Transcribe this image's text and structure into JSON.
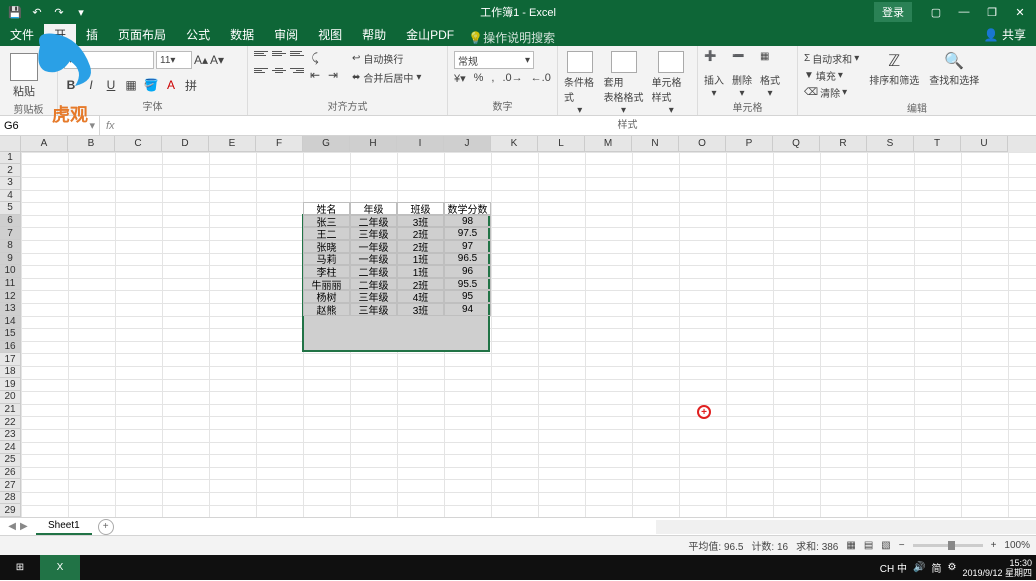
{
  "title_doc": "工作簿1 - Excel",
  "login_label": "登录",
  "tabs": [
    "文件",
    "开",
    "插",
    "页面布局",
    "公式",
    "数据",
    "审阅",
    "视图",
    "帮助",
    "金山PDF"
  ],
  "search_hint": "操作说明搜索",
  "share_label": "共享",
  "ribbon": {
    "clipboard": {
      "paste": "粘贴",
      "label": "剪贴板"
    },
    "font": {
      "size": "11",
      "label": "字体"
    },
    "align": {
      "wrap": "自动换行",
      "merge": "合并后居中",
      "label": "对齐方式"
    },
    "number": {
      "format": "常规",
      "label": "数字"
    },
    "styles": {
      "cond": "条件格式",
      "table": "套用\n表格格式",
      "cellstyle": "单元格样式",
      "label": "样式"
    },
    "cells": {
      "insert": "插入",
      "delete": "删除",
      "format": "格式",
      "label": "单元格"
    },
    "editing": {
      "sum": "自动求和",
      "fill": "填充",
      "clear": "清除",
      "sort": "排序和筛选",
      "find": "查找和选择",
      "label": "编辑"
    }
  },
  "namebox": "G6",
  "columns": [
    "A",
    "B",
    "C",
    "D",
    "E",
    "F",
    "G",
    "H",
    "I",
    "J",
    "K",
    "L",
    "M",
    "N",
    "O",
    "P",
    "Q",
    "R",
    "S",
    "T",
    "U"
  ],
  "row_count": 29,
  "table": {
    "headers": [
      "姓名",
      "年级",
      "班级",
      "数学分数"
    ],
    "rows": [
      [
        "张三",
        "二年级",
        "3班",
        "98"
      ],
      [
        "王二",
        "三年级",
        "2班",
        "97.5"
      ],
      [
        "张晓",
        "一年级",
        "2班",
        "97"
      ],
      [
        "马莉",
        "一年级",
        "1班",
        "96.5"
      ],
      [
        "李柱",
        "二年级",
        "1班",
        "96"
      ],
      [
        "牛丽丽",
        "二年级",
        "2班",
        "95.5"
      ],
      [
        "杨树",
        "三年级",
        "4班",
        "95"
      ],
      [
        "赵熊",
        "三年级",
        "3班",
        "94"
      ]
    ]
  },
  "sheet_tab": "Sheet1",
  "statusbar": {
    "avg_lbl": "平均值:",
    "avg": "96.5",
    "cnt_lbl": "计数:",
    "cnt": "16",
    "sum_lbl": "求和:",
    "sum": "386",
    "zoom": "100%"
  },
  "chart_data": {
    "type": "table",
    "title": "数学分数",
    "columns": [
      "姓名",
      "年级",
      "班级",
      "数学分数"
    ],
    "rows": [
      [
        "张三",
        "二年级",
        "3班",
        98
      ],
      [
        "王二",
        "三年级",
        "2班",
        97.5
      ],
      [
        "张晓",
        "一年级",
        "2班",
        97
      ],
      [
        "马莉",
        "一年级",
        "1班",
        96.5
      ],
      [
        "李柱",
        "二年级",
        "1班",
        96
      ],
      [
        "牛丽丽",
        "二年级",
        "2班",
        95.5
      ],
      [
        "杨树",
        "三年级",
        "4班",
        95
      ],
      [
        "赵熊",
        "三年级",
        "3班",
        94
      ]
    ]
  },
  "taskbar": {
    "ime": "CH 中",
    "tray": "简",
    "time": "15:30",
    "date": "2019/9/12 星期四"
  }
}
